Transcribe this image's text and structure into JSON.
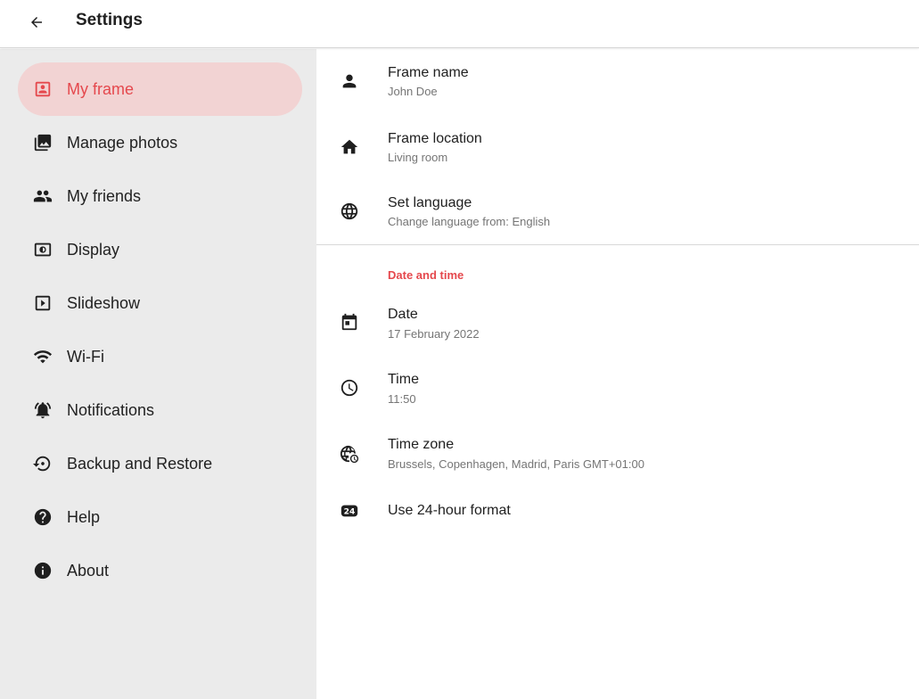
{
  "appbar": {
    "title": "Settings",
    "back_icon": "arrow-back-icon"
  },
  "colors": {
    "accent": "#e5484d",
    "active_bg": "#f2d3d3",
    "sidebar_bg": "#ebebeb"
  },
  "sidebar": {
    "items": [
      {
        "label": "My frame",
        "icon": "portrait-frame-icon",
        "active": true
      },
      {
        "label": "Manage photos",
        "icon": "photo-library-icon"
      },
      {
        "label": "My friends",
        "icon": "people-icon"
      },
      {
        "label": "Display",
        "icon": "brightness-screen-icon"
      },
      {
        "label": "Slideshow",
        "icon": "slideshow-icon"
      },
      {
        "label": "Wi-Fi",
        "icon": "wifi-icon"
      },
      {
        "label": "Notifications",
        "icon": "notification-bell-icon"
      },
      {
        "label": "Backup and Restore",
        "icon": "backup-restore-icon"
      },
      {
        "label": "Help",
        "icon": "help-icon"
      },
      {
        "label": "About",
        "icon": "info-icon"
      }
    ]
  },
  "settings": {
    "frame_name": {
      "title": "Frame name",
      "value": "John Doe",
      "icon": "person-icon"
    },
    "frame_location": {
      "title": "Frame location",
      "value": "Living room",
      "icon": "home-icon"
    },
    "language": {
      "title": "Set language",
      "value": "Change language from: English",
      "icon": "globe-icon"
    },
    "date_time_header": "Date and time",
    "date": {
      "title": "Date",
      "value": "17 February 2022",
      "icon": "calendar-icon"
    },
    "time": {
      "title": "Time",
      "value": "11:50",
      "icon": "clock-icon"
    },
    "time_zone": {
      "title": "Time zone",
      "value": "Brussels, Copenhagen, Madrid, Paris GMT+01:00",
      "icon": "globe-clock-icon"
    },
    "hour_format": {
      "title": "Use 24-hour format",
      "icon": "24-hour-icon"
    }
  }
}
